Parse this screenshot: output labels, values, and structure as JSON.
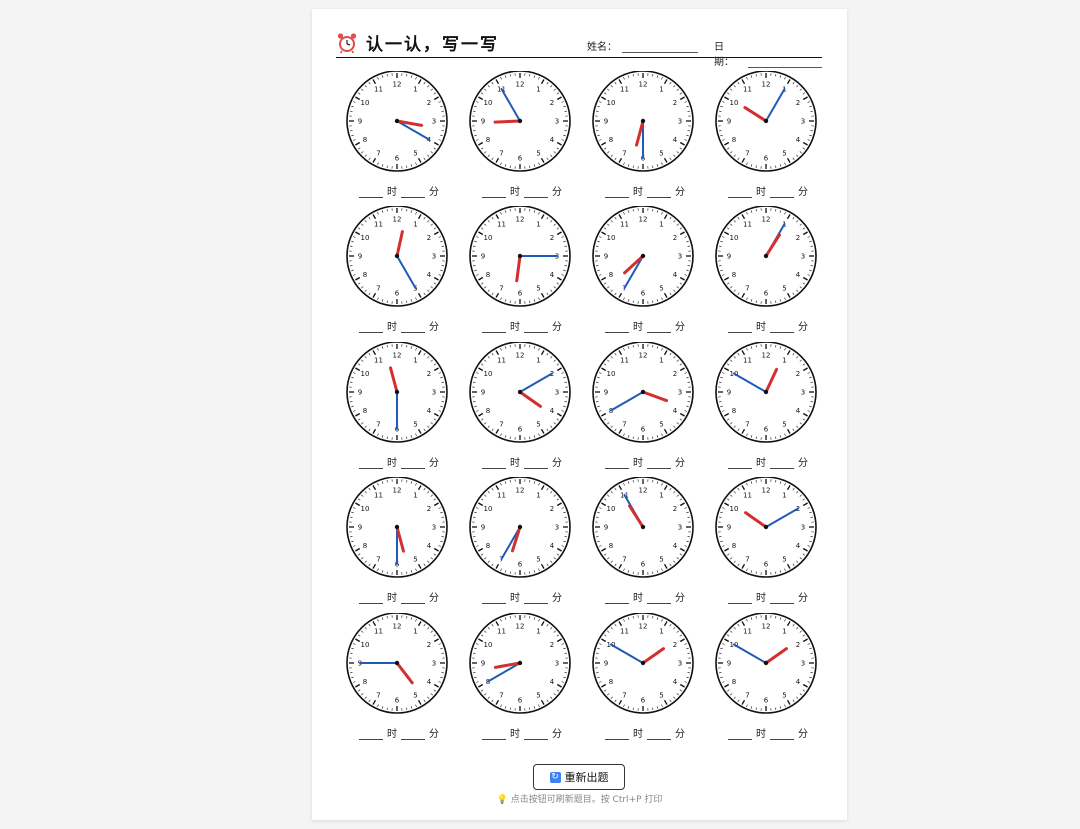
{
  "worksheet": {
    "title": "认一认，写一写",
    "alarm_icon": "alarm-clock-icon",
    "name_label": "姓名：",
    "date_label": "日期：",
    "hour_unit": "时",
    "minute_unit": "分",
    "refresh_label": "重新出题",
    "refresh_icon": "refresh-icon",
    "tip_icon": "lightbulb-icon",
    "tip": "点击按钮可刷新题目。按 Ctrl+P 打印",
    "hour_hand_color": "#d32f2f",
    "minute_hand_color": "#1e5bb8"
  },
  "clocks": [
    {
      "h": 3,
      "m": 20
    },
    {
      "h": 8,
      "m": 55
    },
    {
      "h": 6,
      "m": 30
    },
    {
      "h": 10,
      "m": 5
    },
    {
      "h": 12,
      "m": 25
    },
    {
      "h": 6,
      "m": 15
    },
    {
      "h": 7,
      "m": 35
    },
    {
      "h": 1,
      "m": 5
    },
    {
      "h": 11,
      "m": 30
    },
    {
      "h": 4,
      "m": 10
    },
    {
      "h": 3,
      "m": 40
    },
    {
      "h": 12,
      "m": 50
    },
    {
      "h": 5,
      "m": 30
    },
    {
      "h": 6,
      "m": 35
    },
    {
      "h": 10,
      "m": 55
    },
    {
      "h": 10,
      "m": 10
    },
    {
      "h": 4,
      "m": 45
    },
    {
      "h": 8,
      "m": 40
    },
    {
      "h": 1,
      "m": 50
    },
    {
      "h": 1,
      "m": 50
    }
  ],
  "clock_numerals": [
    "12",
    "1",
    "2",
    "3",
    "4",
    "5",
    "6",
    "7",
    "8",
    "9",
    "10",
    "11"
  ]
}
